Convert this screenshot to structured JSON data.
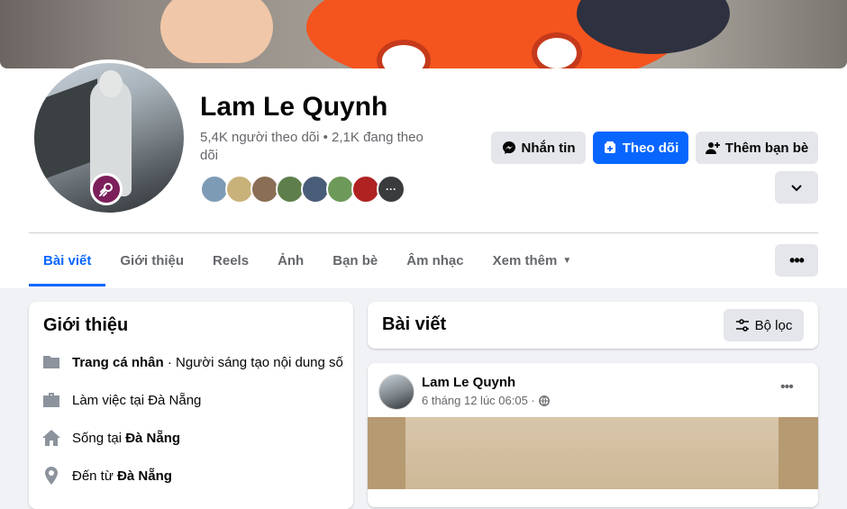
{
  "profile": {
    "name": "Lam Le Quynh",
    "stats": "5,4K người theo dõi • 2,1K đang theo dõi",
    "friend_more": "···",
    "friend_colors": [
      "#7d9bb5",
      "#c9b27a",
      "#8a6e55",
      "#5e7f4b",
      "#4a5d78",
      "#6d9a5a",
      "#b02222",
      "#3a3b3c"
    ]
  },
  "actions": {
    "message": "Nhắn tin",
    "follow": "Theo dõi",
    "add_friend": "Thêm bạn bè"
  },
  "tabs": [
    {
      "label": "Bài viết",
      "active": true
    },
    {
      "label": "Giới thiệu"
    },
    {
      "label": "Reels"
    },
    {
      "label": "Ảnh"
    },
    {
      "label": "Bạn bè"
    },
    {
      "label": "Âm nhạc"
    },
    {
      "label": "Xem thêm"
    }
  ],
  "intro": {
    "title": "Giới thiệu",
    "page_bold": "Trang cá nhân",
    "page_rest": " · Người sáng tạo nội dung số",
    "work": "Làm việc tại Đà Nẵng",
    "lives_prefix": "Sống tại ",
    "lives_city": "Đà Nẵng",
    "from_prefix": "Đến từ ",
    "from_city": "Đà Nẵng"
  },
  "posts": {
    "title": "Bài viết",
    "filter": "Bộ lọc",
    "post": {
      "author": "Lam Le Quynh",
      "time": "6 tháng 12 lúc 06:05 ·"
    }
  },
  "colors": {
    "accent": "#0866ff",
    "badge": "#7c1f5b"
  }
}
